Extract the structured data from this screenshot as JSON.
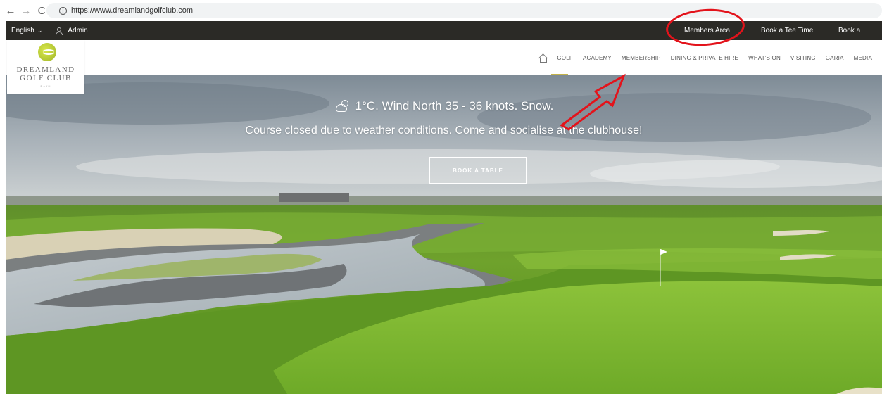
{
  "browser": {
    "url": "https://www.dreamlandgolfclub.com",
    "back_glyph": "←",
    "forward_glyph": "→",
    "reload_glyph": "C",
    "info_glyph": "i"
  },
  "utility_bar": {
    "language": "English",
    "language_chevron": "⌄",
    "admin": "Admin",
    "members_area": "Members Area",
    "book_tee_time": "Book a Tee Time",
    "book_lesson": "Book a Lesson"
  },
  "logo": {
    "line1": "DREAMLAND",
    "line2": "GOLF CLUB",
    "line3": "BAKU"
  },
  "main_nav": {
    "items": [
      "GOLF",
      "ACADEMY",
      "MEMBERSHIP",
      "DINING & PRIVATE HIRE",
      "WHAT'S ON",
      "VISITING",
      "GARIA",
      "MEDIA"
    ]
  },
  "hero": {
    "weather": "1°C. Wind North 35 - 36 knots. Snow.",
    "notice": "Course closed due to weather conditions. Come and socialise at the clubhouse!",
    "button": "BOOK A TABLE"
  },
  "colors": {
    "utility_bg": "#2b2a26",
    "annotation_red": "#e3131b",
    "accent_gold": "#c4b34a",
    "logo_green": "#b5c935"
  }
}
